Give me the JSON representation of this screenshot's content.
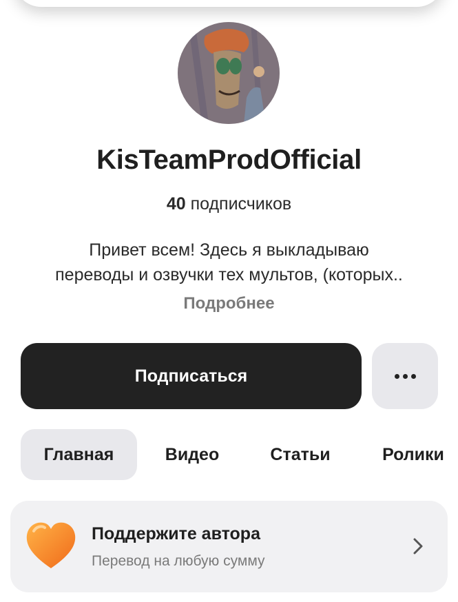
{
  "channel": {
    "name": "KisTeamProdOfficial",
    "subscribers_count": "40",
    "subscribers_label": "подписчиков",
    "description_line1": "Привет всем! Здесь я выкладываю",
    "description_line2": "переводы и озвучки тех мультов, (которых..",
    "more_label": "Подробнее"
  },
  "actions": {
    "subscribe_label": "Подписаться",
    "more_icon": "more-horizontal-icon"
  },
  "tabs": [
    {
      "label": "Главная",
      "active": true
    },
    {
      "label": "Видео",
      "active": false
    },
    {
      "label": "Статьи",
      "active": false
    },
    {
      "label": "Ролики",
      "active": false
    }
  ],
  "support": {
    "title": "Поддержите автора",
    "subtitle": "Перевод на любую сумму",
    "icon": "heart-icon"
  },
  "colors": {
    "primary_button": "#222222",
    "secondary_bg": "#e8e8ec",
    "card_bg": "#f1f1f3",
    "heart": "#f58a2a"
  }
}
